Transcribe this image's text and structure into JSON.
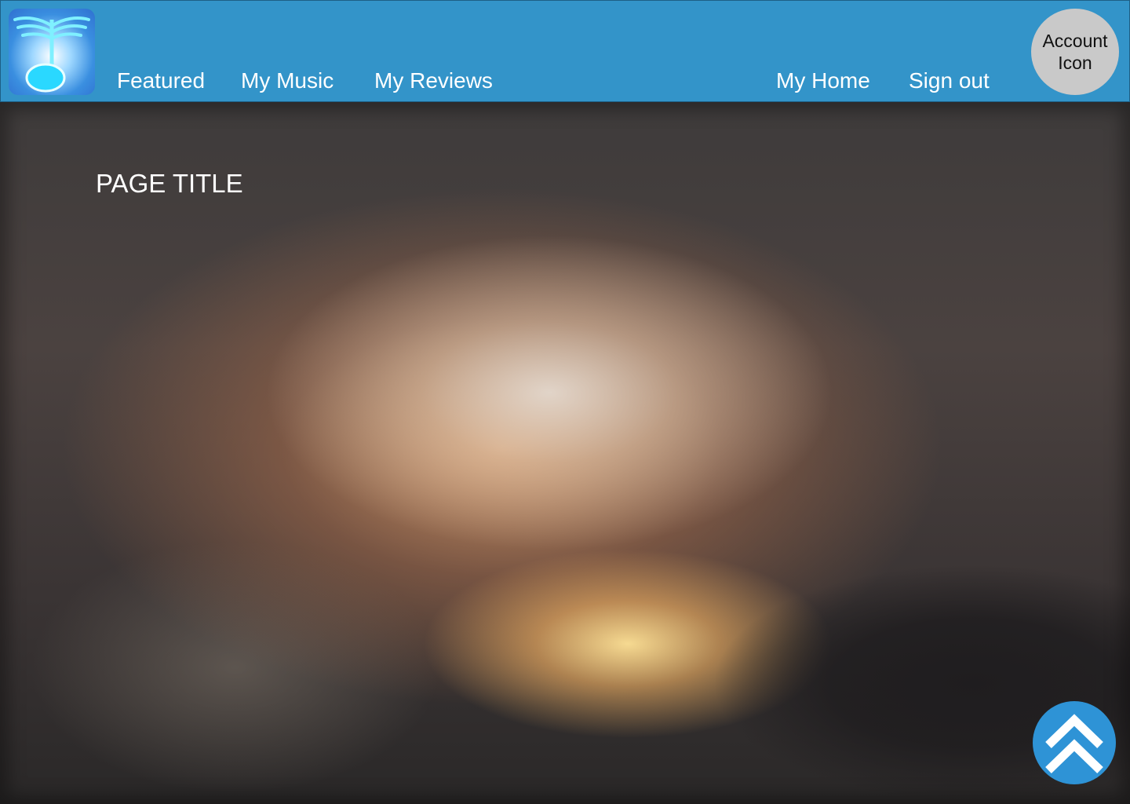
{
  "header": {
    "logo_icon": "winged-music-note-icon",
    "nav_left": [
      {
        "label": "Featured"
      },
      {
        "label": "My Music"
      },
      {
        "label": "My Reviews"
      }
    ],
    "nav_right": [
      {
        "label": "My Home"
      },
      {
        "label": "Sign out"
      }
    ],
    "account_label": "Account Icon"
  },
  "main": {
    "page_title": "PAGE TITLE",
    "background_image": "blurred-sunset-clouds",
    "scroll_top_icon": "double-chevron-up-icon"
  },
  "colors": {
    "header_bg": "#3394c9",
    "account_bg": "#c9c9c9",
    "scroll_button_bg": "#2e93d6",
    "nav_text": "#ffffff"
  }
}
